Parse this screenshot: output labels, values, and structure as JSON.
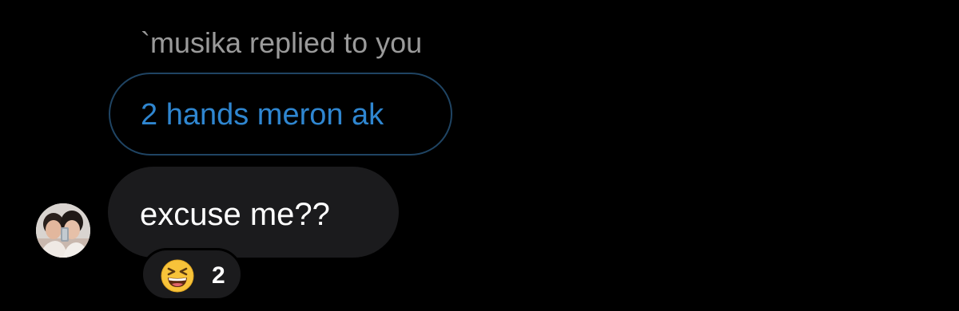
{
  "reply": {
    "header_text": "`musika replied to you",
    "quoted_message": "2 hands meron ak"
  },
  "message": {
    "text": "excuse me??",
    "avatar_icon": "user-avatar-photo"
  },
  "reaction": {
    "emoji_icon": "grinning-squinting-face-icon",
    "count": "2"
  },
  "colors": {
    "background": "#000000",
    "header_text": "#9a9a9a",
    "quoted_text": "#2f86d0",
    "quoted_border": "#1f4463",
    "bubble": "#1b1b1d",
    "message_text": "#ffffff",
    "emoji_face": "#f7c33a"
  }
}
